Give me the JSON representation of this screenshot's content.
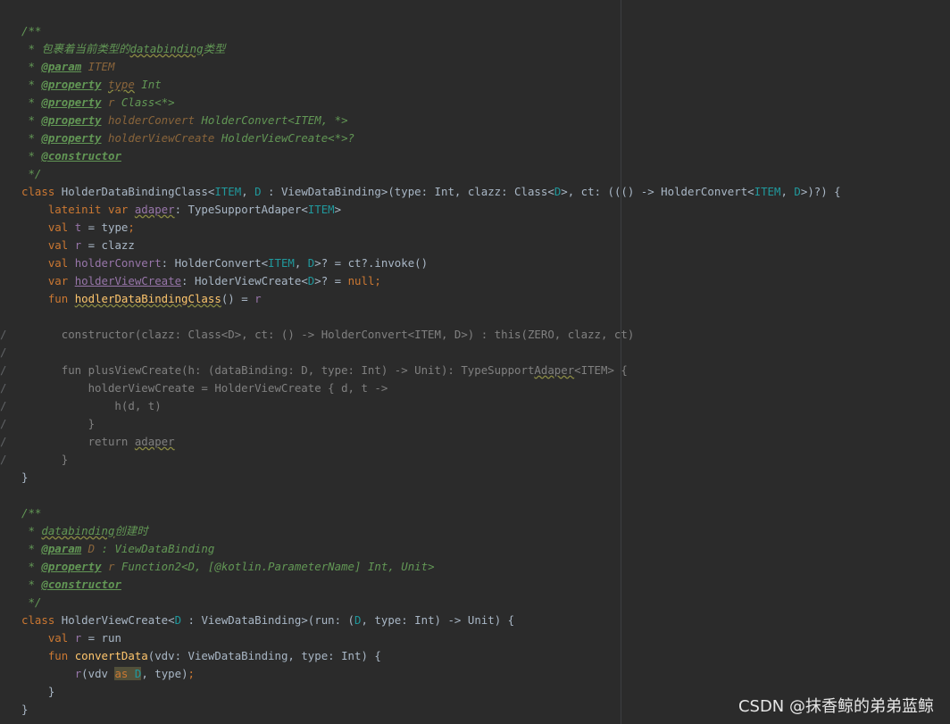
{
  "editor": {
    "lines": [
      {
        "gutter": "",
        "segments": [
          [
            "c-doc",
            "/**"
          ]
        ]
      },
      {
        "gutter": "",
        "segments": [
          [
            "c-doc",
            " * 包裹着当前类型的"
          ],
          [
            "c-doc wv",
            "databinding"
          ],
          [
            "c-doc",
            "类型"
          ]
        ]
      },
      {
        "gutter": "",
        "segments": [
          [
            "c-doc",
            " * "
          ],
          [
            "c-tag",
            "@param"
          ],
          [
            "c-pn",
            " ITEM"
          ]
        ]
      },
      {
        "gutter": "",
        "segments": [
          [
            "c-doc",
            " * "
          ],
          [
            "c-tag",
            "@property"
          ],
          [
            "c-doc",
            " "
          ],
          [
            "c-pn wv",
            "type"
          ],
          [
            "c-doc",
            " Int"
          ]
        ]
      },
      {
        "gutter": "",
        "segments": [
          [
            "c-doc",
            " * "
          ],
          [
            "c-tag",
            "@property"
          ],
          [
            "c-doc",
            " "
          ],
          [
            "c-pn",
            "r"
          ],
          [
            "c-doc",
            " Class<*>"
          ]
        ]
      },
      {
        "gutter": "",
        "segments": [
          [
            "c-doc",
            " * "
          ],
          [
            "c-tag",
            "@property"
          ],
          [
            "c-doc",
            " "
          ],
          [
            "c-pn",
            "holderConvert"
          ],
          [
            "c-doc",
            " HolderConvert<ITEM, *>"
          ]
        ]
      },
      {
        "gutter": "",
        "segments": [
          [
            "c-doc",
            " * "
          ],
          [
            "c-tag",
            "@property"
          ],
          [
            "c-doc",
            " "
          ],
          [
            "c-pn",
            "holderViewCreate"
          ],
          [
            "c-doc",
            " HolderViewCreate<*>?"
          ]
        ]
      },
      {
        "gutter": "",
        "segments": [
          [
            "c-doc",
            " * "
          ],
          [
            "c-tag",
            "@constructor"
          ]
        ]
      },
      {
        "gutter": "",
        "segments": [
          [
            "c-doc",
            " */"
          ]
        ]
      },
      {
        "gutter": "",
        "segments": [
          [
            "kw",
            "class "
          ],
          [
            "",
            "HolderDataBindingClass<"
          ],
          [
            "tp",
            "ITEM"
          ],
          [
            "",
            ", "
          ],
          [
            "tp",
            "D"
          ],
          [
            "",
            " : ViewDataBinding>(type: Int, clazz: Class<"
          ],
          [
            "tp",
            "D"
          ],
          [
            "",
            ">, ct: ((() -> HolderConvert<"
          ],
          [
            "tp",
            "ITEM"
          ],
          [
            "",
            ", "
          ],
          [
            "tp",
            "D"
          ],
          [
            "",
            ">)?) {"
          ]
        ]
      },
      {
        "gutter": "",
        "segments": [
          [
            "",
            "    "
          ],
          [
            "kw",
            "lateinit var "
          ],
          [
            "pp wv",
            "adaper"
          ],
          [
            "",
            ": TypeSupportAdaper<"
          ],
          [
            "tp",
            "ITEM"
          ],
          [
            "",
            ">"
          ]
        ]
      },
      {
        "gutter": "",
        "segments": [
          [
            "",
            "    "
          ],
          [
            "kw",
            "val "
          ],
          [
            "pp",
            "t"
          ],
          [
            "",
            " = type"
          ],
          [
            "kw",
            ";"
          ]
        ]
      },
      {
        "gutter": "",
        "segments": [
          [
            "",
            "    "
          ],
          [
            "kw",
            "val "
          ],
          [
            "pp",
            "r"
          ],
          [
            "",
            " = clazz"
          ]
        ]
      },
      {
        "gutter": "",
        "segments": [
          [
            "",
            "    "
          ],
          [
            "kw",
            "val "
          ],
          [
            "pp",
            "holderConvert"
          ],
          [
            "",
            ": HolderConvert<"
          ],
          [
            "tp",
            "ITEM"
          ],
          [
            "",
            ", "
          ],
          [
            "tp",
            "D"
          ],
          [
            "",
            ">? = ct?.invoke()"
          ]
        ]
      },
      {
        "gutter": "",
        "segments": [
          [
            "",
            "    "
          ],
          [
            "kw",
            "var "
          ],
          [
            "pp ul",
            "holderViewCreate"
          ],
          [
            "",
            ": HolderViewCreate<"
          ],
          [
            "tp",
            "D"
          ],
          [
            "",
            ">? = "
          ],
          [
            "kw",
            "null;"
          ]
        ]
      },
      {
        "gutter": "",
        "segments": [
          [
            "",
            "    "
          ],
          [
            "kw",
            "fun "
          ],
          [
            "fn wv",
            "hodlerDataBindingClass"
          ],
          [
            "",
            "() = "
          ],
          [
            "pp",
            "r"
          ]
        ]
      },
      {
        "gutter": "",
        "segments": []
      },
      {
        "gutter": "/",
        "segments": [
          [
            "dim",
            "      constructor(clazz: Class<D>, ct: () -> HolderConvert<ITEM, D>) : this(ZERO, clazz, ct)"
          ]
        ]
      },
      {
        "gutter": "/",
        "segments": []
      },
      {
        "gutter": "/",
        "segments": [
          [
            "dim",
            "      fun plusViewCreate(h: (dataBinding: D, type: Int) -> Unit): TypeSupport"
          ],
          [
            "dim wv",
            "Adaper"
          ],
          [
            "dim",
            "<ITEM> {"
          ]
        ]
      },
      {
        "gutter": "/",
        "segments": [
          [
            "dim",
            "          holderViewCreate = HolderViewCreate { d, t ->"
          ]
        ]
      },
      {
        "gutter": "/",
        "segments": [
          [
            "dim",
            "              h(d, t)"
          ]
        ]
      },
      {
        "gutter": "/",
        "segments": [
          [
            "dim",
            "          }"
          ]
        ]
      },
      {
        "gutter": "/",
        "segments": [
          [
            "dim",
            "          return "
          ],
          [
            "dim wv",
            "adaper"
          ]
        ]
      },
      {
        "gutter": "/",
        "segments": [
          [
            "dim",
            "      }"
          ]
        ]
      },
      {
        "gutter": "",
        "segments": [
          [
            "",
            "}"
          ]
        ]
      },
      {
        "gutter": "",
        "segments": []
      },
      {
        "gutter": "",
        "segments": [
          [
            "c-doc",
            "/**"
          ]
        ]
      },
      {
        "gutter": "",
        "segments": [
          [
            "c-doc",
            " * "
          ],
          [
            "c-doc wv",
            "databinding"
          ],
          [
            "c-doc",
            "创建时"
          ]
        ]
      },
      {
        "gutter": "",
        "segments": [
          [
            "c-doc",
            " * "
          ],
          [
            "c-tag",
            "@param"
          ],
          [
            "c-pn",
            " D"
          ],
          [
            "c-doc",
            " : ViewDataBinding"
          ]
        ]
      },
      {
        "gutter": "",
        "segments": [
          [
            "c-doc",
            " * "
          ],
          [
            "c-tag",
            "@property"
          ],
          [
            "c-doc",
            " "
          ],
          [
            "c-pn",
            "r"
          ],
          [
            "c-doc",
            " Function2<D, [@kotlin.ParameterName] Int, Unit>"
          ]
        ]
      },
      {
        "gutter": "",
        "segments": [
          [
            "c-doc",
            " * "
          ],
          [
            "c-tag",
            "@constructor"
          ]
        ]
      },
      {
        "gutter": "",
        "segments": [
          [
            "c-doc",
            " */"
          ]
        ]
      },
      {
        "gutter": "",
        "segments": [
          [
            "kw",
            "class "
          ],
          [
            "",
            "HolderViewCreate<"
          ],
          [
            "tp",
            "D"
          ],
          [
            "",
            " : ViewDataBinding>(run: ("
          ],
          [
            "tp",
            "D"
          ],
          [
            "",
            ", type: Int) -> Unit) {"
          ]
        ]
      },
      {
        "gutter": "",
        "segments": [
          [
            "",
            "    "
          ],
          [
            "kw",
            "val "
          ],
          [
            "pp",
            "r"
          ],
          [
            "",
            " = run"
          ]
        ]
      },
      {
        "gutter": "",
        "segments": [
          [
            "",
            "    "
          ],
          [
            "kw",
            "fun "
          ],
          [
            "fn",
            "convertData"
          ],
          [
            "",
            "(vdv: ViewDataBinding, type: Int) {"
          ]
        ]
      },
      {
        "gutter": "",
        "segments": [
          [
            "",
            "        "
          ],
          [
            "pp",
            "r"
          ],
          [
            "",
            "(vdv "
          ],
          [
            "kw hl",
            "as "
          ],
          [
            "tp hl",
            "D"
          ],
          [
            "",
            ", type)"
          ],
          [
            "kw",
            ";"
          ]
        ]
      },
      {
        "gutter": "",
        "segments": [
          [
            "",
            "    }"
          ]
        ]
      },
      {
        "gutter": "",
        "segments": [
          [
            "",
            "}"
          ]
        ]
      }
    ]
  },
  "watermark": "CSDN @抹香鲸的弟弟蓝鲸"
}
